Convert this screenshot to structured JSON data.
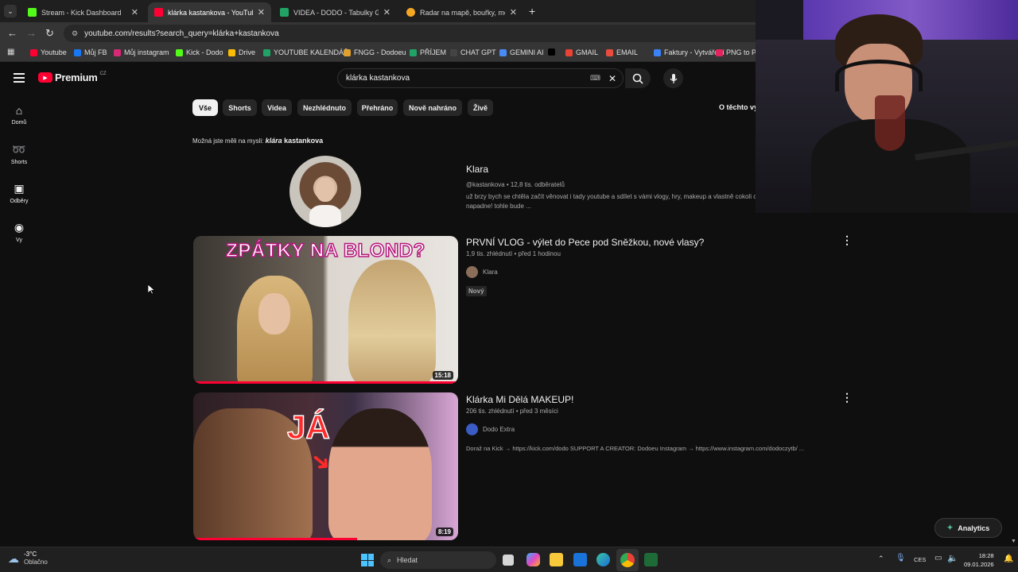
{
  "browser": {
    "tabs": [
      {
        "label": "Stream - Kick Dashboard",
        "icon": "kick-icon",
        "color": "#53fc18"
      },
      {
        "label": "klárka kastankova - YouTube",
        "icon": "youtube-icon",
        "color": "#ff0033"
      },
      {
        "label": "VIDEA - DODO - Tabulky Goog",
        "icon": "sheets-icon",
        "color": "#21a366"
      },
      {
        "label": "Radar na mapě, bouřky, meteo",
        "icon": "radar-icon",
        "color": "#f5a623"
      }
    ],
    "url": "youtube.com/results?search_query=klárka+kastankova",
    "bookmarks": [
      {
        "label": "Youtube",
        "color": "#ff0033"
      },
      {
        "label": "Můj FB",
        "color": "#1877f2"
      },
      {
        "label": "Můj instagram",
        "color": "#d62976"
      },
      {
        "label": "Kick - Dodo",
        "color": "#53fc18"
      },
      {
        "label": "Drive",
        "color": "#fbbc04"
      },
      {
        "label": "YOUTUBE KALENDÁŘ",
        "color": "#21a366"
      },
      {
        "label": "FNGG - Dodoeu",
        "color": "#e0a030"
      },
      {
        "label": "PŘÍJEM",
        "color": "#21a366"
      },
      {
        "label": "CHAT GPT",
        "color": "#444444"
      },
      {
        "label": "GEMINI AI",
        "color": "#4a8af4"
      },
      {
        "label": "",
        "color": "#000000"
      },
      {
        "label": "GMAIL",
        "color": "#ea4335"
      },
      {
        "label": "EMAIL",
        "color": "#e84c3d"
      },
      {
        "label": "Faktury - Vytváření",
        "color": "#3b82f6"
      },
      {
        "label": "PNG to PD",
        "color": "#e0245e"
      }
    ]
  },
  "youtube": {
    "logo_text": "Premium",
    "region": "CZ",
    "search_value": "klárka kastankova",
    "sidebar": [
      {
        "label": "Domů",
        "icon": "home-icon"
      },
      {
        "label": "Shorts",
        "icon": "shorts-icon"
      },
      {
        "label": "Odběry",
        "icon": "subscriptions-icon"
      },
      {
        "label": "Vy",
        "icon": "you-icon"
      }
    ],
    "chips": [
      "Vše",
      "Shorts",
      "Videa",
      "Nezhlédnuto",
      "Přehráno",
      "Nově nahráno",
      "Živě"
    ],
    "about_results": "O těchto vý",
    "did_you_mean_prefix": "Možná jste měli na mysli:",
    "did_you_mean_bold": "klára",
    "did_you_mean_rest": " kastankova",
    "channel": {
      "name": "Klara",
      "handle": "@kastankova",
      "subs": "12,8 tis. odběratelů",
      "desc1": "už brzy bych se chtěla začít věnovat i tady youtube a sdílet s vámi vlogy, hry, makeup a vlastně cokoli co",
      "desc2": "napadne! tohle bude ..."
    },
    "videos": [
      {
        "title": "PRVNÍ VLOG - výlet do Pece pod Sněžkou, nové vlasy?",
        "views": "1,9 tis. zhlédnutí",
        "age": "před 1 hodinou",
        "channel": "Klara",
        "badge": "Nový",
        "duration": "15:18",
        "thumb_text": "ZPÁTKY NA BLOND?",
        "progress": 1.0
      },
      {
        "title": "Klárka Mi Dělá MAKEUP!",
        "views": "206 tis. zhlédnutí",
        "age": "před 3 měsíci",
        "channel": "Dodo Extra",
        "desc": "Doraž na Kick → https://kick.com/dodo SUPPORT A CREATOR: Dodoeu Instagram → https://www.instagram.com/dodoczytb/ ...",
        "duration": "8:19",
        "thumb_text": "JÁ",
        "progress": 0.62
      }
    ]
  },
  "analytics_button": "Analytics",
  "taskbar": {
    "weather_temp": "-3°C",
    "weather_text": "Oblačno",
    "search_placeholder": "Hledat",
    "lang": "CES",
    "time": "18:28",
    "date": "09.01.2026"
  }
}
